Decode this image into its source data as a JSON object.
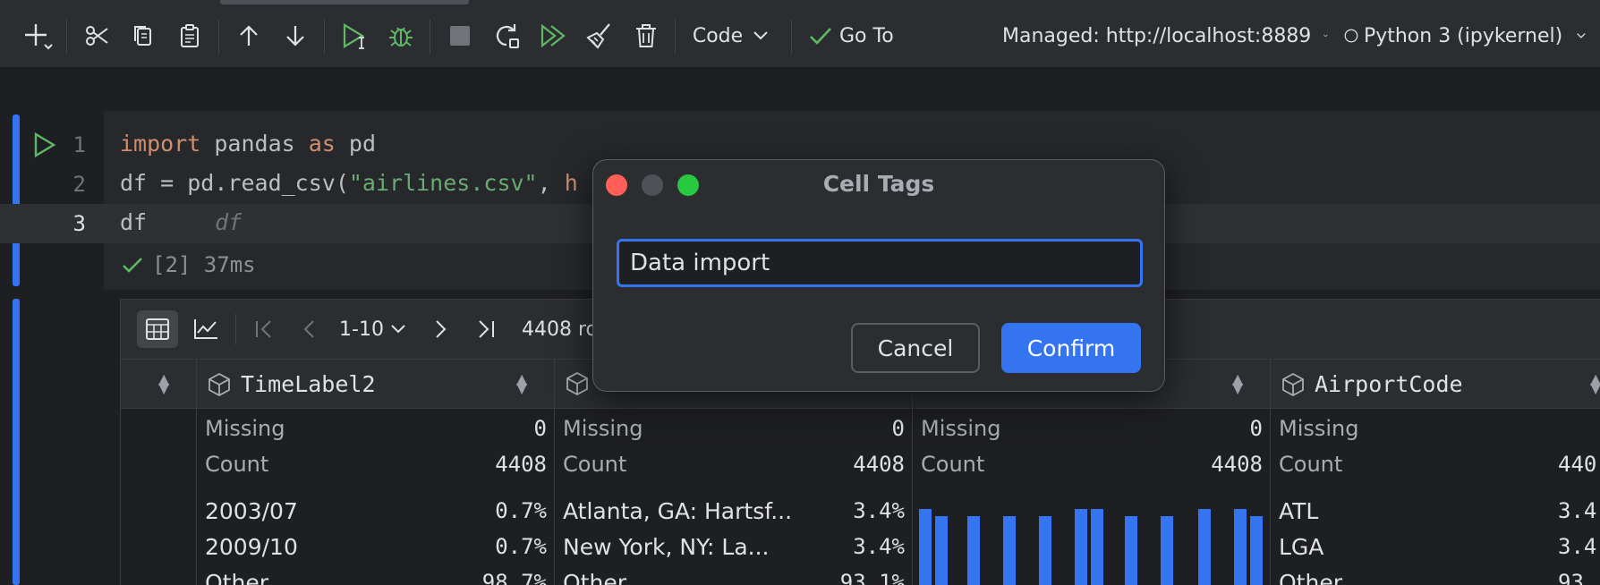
{
  "toolbar": {
    "cell_type": "Code",
    "goto": "Go To",
    "server": "Managed: http://localhost:8889",
    "kernel": "Python 3 (ipykernel)"
  },
  "code": {
    "line_numbers": [
      "1",
      "2",
      "3"
    ],
    "line1": {
      "kw1": "import",
      "t1": " pandas ",
      "kw2": "as",
      "t2": " pd"
    },
    "line2": {
      "t1": "df = pd.read_csv(",
      "str": "\"airlines.csv\"",
      "t2": ", ",
      "cut": "h"
    },
    "line3": {
      "t1": "df",
      "hint": "df"
    },
    "status": "[2] 37ms"
  },
  "output": {
    "range": "1-10",
    "rows_text": "4408 ro",
    "columns": [
      {
        "header": "TimeLabel2",
        "missing_label": "Missing",
        "missing": "0",
        "count_label": "Count",
        "count": "4408",
        "values": [
          {
            "label": "2003/07",
            "pct": "0.7%"
          },
          {
            "label": "2009/10",
            "pct": "0.7%"
          },
          {
            "label": "Other",
            "pct": "98.7%"
          }
        ]
      },
      {
        "header": "",
        "missing_label": "Missing",
        "missing": "0",
        "count_label": "Count",
        "count": "4408",
        "values": [
          {
            "label": "Atlanta, GA: Hartsf...",
            "pct": "3.4%"
          },
          {
            "label": "New York, NY: La...",
            "pct": "3.4%"
          },
          {
            "label": "Other",
            "pct": "93.1%"
          }
        ]
      },
      {
        "header": "",
        "missing_label": "Missing",
        "missing": "0",
        "count_label": "Count",
        "count": "4408"
      },
      {
        "header": "AirportCode",
        "missing_label": "Missing",
        "missing": "",
        "count_label": "Count",
        "count": "440",
        "values": [
          {
            "label": "ATL",
            "pct": "3.4"
          },
          {
            "label": "LGA",
            "pct": "3.4"
          },
          {
            "label": "Other",
            "pct": "93"
          }
        ]
      }
    ]
  },
  "dialog": {
    "title": "Cell Tags",
    "input_value": "Data import",
    "cancel": "Cancel",
    "confirm": "Confirm"
  },
  "colors": {
    "accent": "#3574f0",
    "run_green": "#5fb865",
    "close_red": "#ff5f57",
    "zoom_green": "#28c840"
  }
}
